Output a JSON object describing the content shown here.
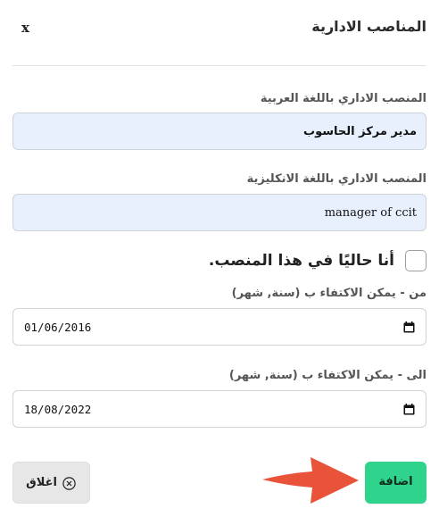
{
  "dialog": {
    "title": "المناصب الادارية",
    "close_label": "x"
  },
  "fields": {
    "position_ar": {
      "label": "المنصب الاداري باللغة العربية",
      "value": "مدير مركز الحاسوب"
    },
    "position_en": {
      "label": "المنصب الاداري باللغة الانكليزية",
      "value": "manager of ccit"
    }
  },
  "current_position": {
    "label": "أنا حاليًا في هذا المنصب.",
    "checked": false
  },
  "dates": {
    "from": {
      "label": "من - يمكن الاكتفاء ب (سنة, شهر)",
      "value": "01/06/2016"
    },
    "to": {
      "label": "الى - يمكن الاكتفاء ب (سنة, شهر)",
      "value": "18/08/2022"
    }
  },
  "buttons": {
    "close_label": "اغلاق",
    "add_label": "اضافة"
  },
  "colors": {
    "add_button": "#2fd38b",
    "input_fill": "#e8f0fe",
    "arrow": "#e8533a",
    "close_button": "#e7e7e7"
  },
  "icons": [
    "calendar-icon",
    "circle-x-icon",
    "arrow-icon"
  ]
}
